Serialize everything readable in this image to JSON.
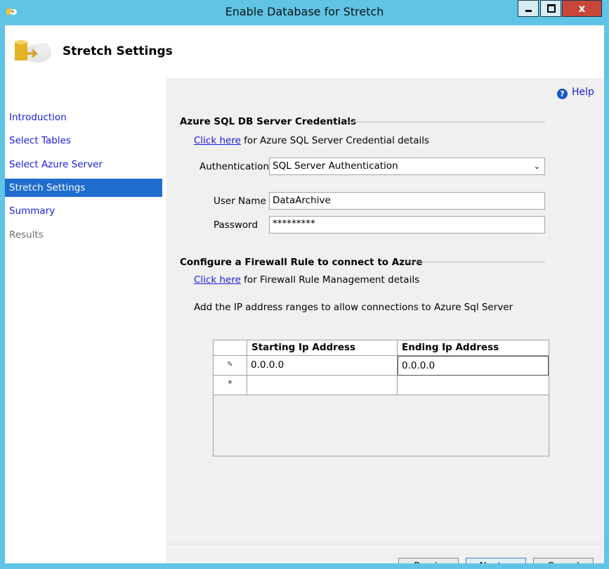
{
  "window": {
    "title": "Enable Database for Stretch",
    "close_glyph": "x"
  },
  "header": {
    "title": "Stretch Settings"
  },
  "nav": {
    "items": [
      {
        "label": "Introduction",
        "state": "link"
      },
      {
        "label": "Select Tables",
        "state": "link"
      },
      {
        "label": "Select Azure Server",
        "state": "link"
      },
      {
        "label": "Stretch Settings",
        "state": "active"
      },
      {
        "label": "Summary",
        "state": "link"
      },
      {
        "label": "Results",
        "state": "disabled"
      }
    ]
  },
  "help": {
    "label": "Help",
    "icon": "question-icon",
    "glyph": "?"
  },
  "credentials": {
    "section_title": "Azure SQL DB Server Credentials",
    "link_text": "Click here",
    "link_suffix": " for Azure SQL Server Credential details",
    "auth_label": "Authentication",
    "auth_value": "SQL Server Authentication",
    "username_label": "User Name",
    "username_value": "DataArchive",
    "password_label": "Password",
    "password_value": "*********"
  },
  "firewall": {
    "section_title": "Configure a Firewall Rule to connect to Azure",
    "link_text": "Click here",
    "link_suffix": " for Firewall Rule Management details",
    "instructions": "Add the IP address ranges to allow connections to Azure Sql Server",
    "columns": [
      "Starting Ip Address",
      "Ending Ip Address"
    ],
    "rows": [
      {
        "marker": "✎",
        "start": "0.0.0.0",
        "end": "0.0.0.0"
      },
      {
        "marker": "*",
        "start": "",
        "end": ""
      }
    ]
  },
  "buttons": {
    "previous": "< Previous",
    "next": "Next >",
    "cancel": "Cancel"
  },
  "colors": {
    "accent": "#1f6dce",
    "link": "#1a1ae0",
    "frame": "#5fc4e6"
  }
}
